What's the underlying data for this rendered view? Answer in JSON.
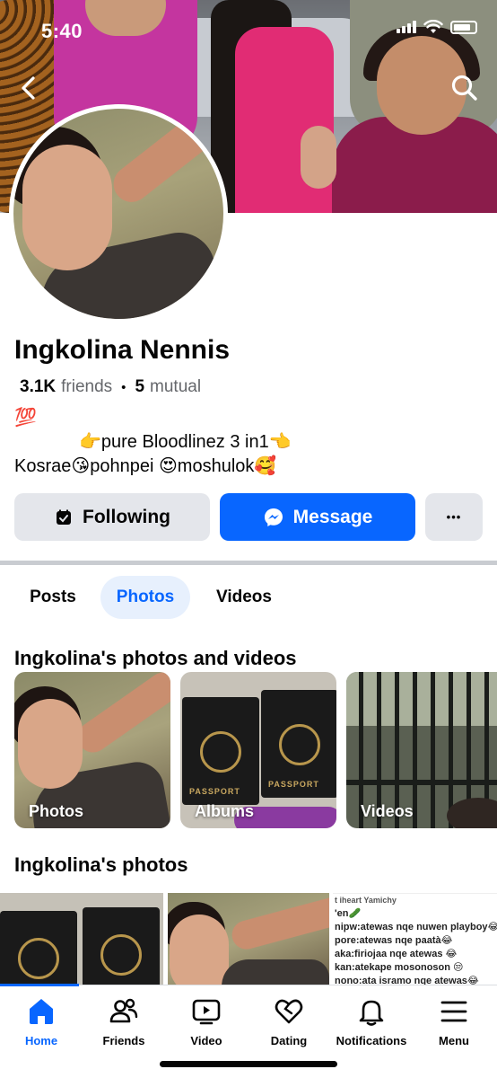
{
  "status_bar": {
    "time": "5:40"
  },
  "profile": {
    "name": "Ingkolina Nennis",
    "friends_count": "3.1K",
    "friends_label": "friends",
    "mutual_count": "5",
    "mutual_label": "mutual",
    "separator": "•",
    "bio_lines": [
      "💯",
      "👉pure Bloodlinez 3 in1👈",
      "Kosrae😘pohnpei 😍moshulok🥰"
    ]
  },
  "actions": {
    "following_label": "Following",
    "message_label": "Message",
    "more_label": "•••"
  },
  "tabs": [
    {
      "label": "Posts",
      "active": false
    },
    {
      "label": "Photos",
      "active": true
    },
    {
      "label": "Videos",
      "active": false
    }
  ],
  "photos_and_videos": {
    "title": "Ingkolina's photos and videos",
    "tiles": [
      {
        "label": "Photos"
      },
      {
        "label": "Albums",
        "passport_text": "PASSPORT"
      },
      {
        "label": "Videos"
      }
    ]
  },
  "photos": {
    "title": "Ingkolina's photos",
    "text_post_lines": [
      "t iheart Yamichy",
      "'en🥒",
      "nipw:atewas nqe nuwen playboy😂",
      "pore:atewas nqe paatà😂",
      "aka:firiojaa nqe atewas 😂",
      "kan:atekape mosonoson 😒",
      "nono:ata isramo nqe atewas😂"
    ]
  },
  "bottom_nav": [
    {
      "label": "Home",
      "icon": "home-icon",
      "active": true
    },
    {
      "label": "Friends",
      "icon": "friends-icon",
      "active": false
    },
    {
      "label": "Video",
      "icon": "video-icon",
      "active": false
    },
    {
      "label": "Dating",
      "icon": "heart-icon",
      "active": false
    },
    {
      "label": "Notifications",
      "icon": "bell-icon",
      "active": false
    },
    {
      "label": "Menu",
      "icon": "menu-icon",
      "active": false
    }
  ],
  "colors": {
    "accent": "#0866ff",
    "button_gray": "#e4e6eb",
    "tab_active_bg": "#e7f0fd"
  }
}
